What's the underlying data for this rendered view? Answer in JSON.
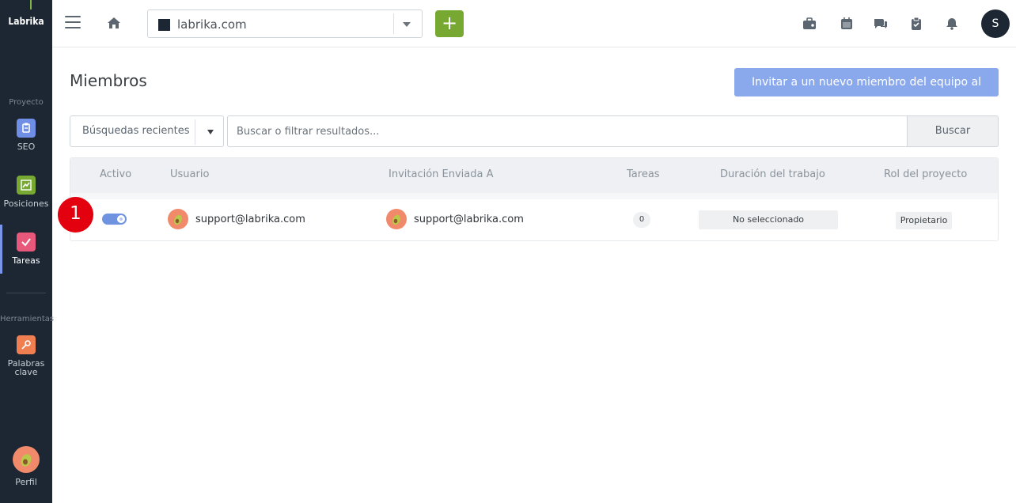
{
  "sidebar": {
    "logo": "Labrika",
    "sections": {
      "project": "Proyecto",
      "tools": "Herramientas"
    },
    "items": [
      {
        "label": "SEO",
        "color": "#6f8ee6"
      },
      {
        "label": "Posiciones",
        "color": "#76a832"
      },
      {
        "label": "Tareas",
        "color": "#e8587a"
      },
      {
        "label": "Palabras clave",
        "color": "#ef7e51"
      }
    ],
    "profile": "Perfil"
  },
  "topbar": {
    "site": "labrika.com",
    "plus": "+",
    "user_initial": "S",
    "icons": [
      "briefcase-icon",
      "calendar-icon",
      "chat-icon",
      "clipboard-icon",
      "bell-icon"
    ]
  },
  "main": {
    "title": "Miembros",
    "invite_button": "Invitar a un nuevo miembro del equipo al proyecto",
    "recent_searches": "Búsquedas recientes",
    "search_placeholder": "Buscar o filtrar resultados...",
    "search_button": "Buscar"
  },
  "table": {
    "headers": [
      "Activo",
      "Usuario",
      "Invitación Enviada A",
      "Tareas",
      "Duración del trabajo",
      "Rol del proyecto"
    ],
    "rows": [
      {
        "active": true,
        "user": "support@labrika.com",
        "invitation": "support@labrika.com",
        "tasks": "0",
        "duration": "No seleccionado",
        "role": "Propietario"
      }
    ]
  },
  "marker": "1",
  "colors": {
    "sidebar_bg": "#1d2733",
    "accent_green": "#76a832",
    "invite_blue": "#8aa8ec",
    "toggle_blue": "#6f93e0",
    "marker_red": "#e3000f"
  }
}
